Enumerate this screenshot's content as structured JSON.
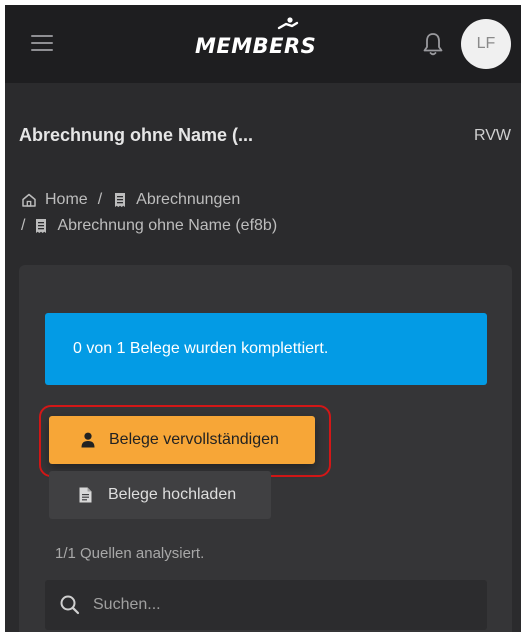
{
  "header": {
    "logo_text": "MEMBERS",
    "avatar_initials": "LF",
    "menu_icon": "hamburger-icon",
    "notification_icon": "bell-icon"
  },
  "page": {
    "title": "Abrechnung ohne Name (...",
    "tag": "RVW"
  },
  "breadcrumb": {
    "home": "Home",
    "separator": "/",
    "level1": "Abrechnungen",
    "level2": "Abrechnung ohne Name (ef8b)"
  },
  "card": {
    "alert_text": "0 von 1 Belege wurden komplettiert.",
    "complete_button_label": "Belege vervollständigen",
    "upload_button_label": "Belege hochladen",
    "sources_text": "1/1 Quellen analysiert.",
    "search_placeholder": "Suchen..."
  },
  "colors": {
    "topbar": "#1e1e20",
    "background": "#2b2b2d",
    "card": "#353537",
    "alert_info": "#039be5",
    "primary_button": "#f7a637",
    "highlight_ring": "#d31717"
  }
}
